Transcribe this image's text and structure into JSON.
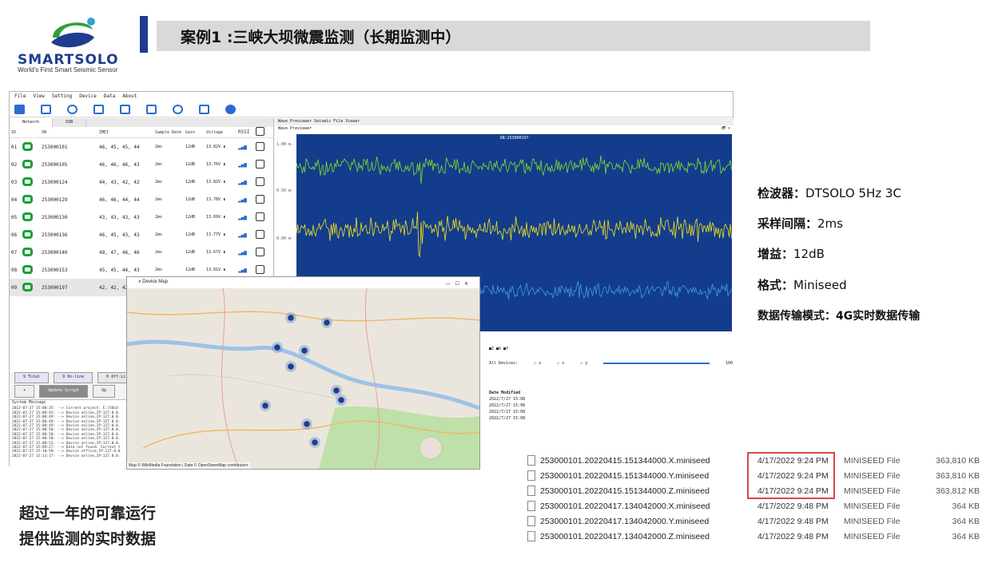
{
  "logo": {
    "brand": "SMARTSOLO",
    "tagline": "World's First Smart Seismic Sensor"
  },
  "title": "案例1 :三峡大坝微震监测（长期监测中）",
  "menu": [
    "File",
    "View",
    "Setting",
    "Device",
    "Data",
    "About"
  ],
  "left_tabs": [
    "Network",
    "USB"
  ],
  "table_headers": [
    "ID",
    "SN",
    "IMEI",
    "Sample Rate",
    "Gain",
    "Voltage",
    "RSSI"
  ],
  "devices": [
    {
      "id": "01",
      "sn": "253000101",
      "sw": "46, 45, 45, 44",
      "rate": "2ms",
      "gain": "12dB",
      "volt": "13.82V"
    },
    {
      "id": "02",
      "sn": "253000105",
      "sw": "46, 46, 46, 43",
      "rate": "2ms",
      "gain": "12dB",
      "volt": "13.76V"
    },
    {
      "id": "03",
      "sn": "253000124",
      "sw": "44, 43, 42, 42",
      "rate": "2ms",
      "gain": "12dB",
      "volt": "13.82V"
    },
    {
      "id": "04",
      "sn": "253000129",
      "sw": "46, 46, 44, 44",
      "rate": "2ms",
      "gain": "12dB",
      "volt": "13.78V"
    },
    {
      "id": "05",
      "sn": "253000130",
      "sw": "43, 43, 43, 43",
      "rate": "2ms",
      "gain": "12dB",
      "volt": "13.69V"
    },
    {
      "id": "06",
      "sn": "253000136",
      "sw": "46, 45, 43, 43",
      "rate": "2ms",
      "gain": "12dB",
      "volt": "13.77V"
    },
    {
      "id": "07",
      "sn": "253000140",
      "sw": "48, 47, 46, 46",
      "rate": "2ms",
      "gain": "12dB",
      "volt": "13.67V"
    },
    {
      "id": "08",
      "sn": "253000153",
      "sw": "45, 45, 44, 43",
      "rate": "2ms",
      "gain": "12dB",
      "volt": "13.81V"
    },
    {
      "id": "09",
      "sn": "253000197",
      "sw": "42, 42, 42, 40",
      "rate": "2ms",
      "gain": "12dB",
      "volt": "13.61V"
    }
  ],
  "buttons": {
    "total": "9 Total",
    "online": "9 On-line",
    "offline": "0 Off-Li",
    "update": "Update Script",
    "up": "Up"
  },
  "sysmsg": {
    "header": "System Message",
    "lines": [
      "2022-07-27 15:08:35: --> Current project: E:/SOLO",
      "2022-07-27 15:08:43: --> Device online,IP:127.0.0.",
      "2022-07-27 15:08:49: --> Device online,IP:127.0.0.",
      "2022-07-27 15:08:49: --> Device online,IP:127.0.0.",
      "2022-07-27 15:08:49: --> Device online,IP:127.0.0.",
      "2022-07-27 15:08:50: --> Device online,IP:127.0.0.",
      "2022-07-27 15:08:50: --> Device online,IP:127.0.0.",
      "2022-07-27 15:08:50: --> Device online,IP:127.0.0.",
      "2022-07-27 15:08:53: --> Device online,IP:127.0.0.",
      "2022-07-27 15:09:27: --> Data not found. Current t",
      "2022-07-27 15:10:58: --> Device offline,IP:127.0.0",
      "2022-07-27 15:11:17: --> Device online,IP:127.0.0."
    ]
  },
  "right_tabs": "Wave Previewer   Seismic File Viewer",
  "wave": {
    "panel": "Wave Previewer",
    "sn": "SN:253000197",
    "y_labels": [
      "1.00 m-",
      "0.50 m-",
      "0.00 m-"
    ],
    "legend": "■Z ■X ■Y",
    "all_devices": "All Devices:",
    "checks": [
      "z",
      "x",
      "y"
    ],
    "value": "100"
  },
  "date_modified": {
    "header": "Date Modified",
    "rows": [
      "2022/7/27 15:08",
      "2022/7/27 15:08",
      "2022/7/27 15:08",
      "2022/7/27 15:08"
    ]
  },
  "map": {
    "title": "Device Map",
    "attribution": "Map © WikiMedia Foundation | Data © OpenStreetMap contributors"
  },
  "specs": [
    {
      "k": "检波器：",
      "v": "DTSOLO 5Hz 3C"
    },
    {
      "k": "采样间隔：",
      "v": "2ms"
    },
    {
      "k": "增益：",
      "v": "12dB"
    },
    {
      "k": "格式：",
      "v": "Miniseed"
    },
    {
      "k": "数据传输模式：",
      "v": "4G实时数据传输"
    }
  ],
  "captions": [
    "超过一年的可靠运行",
    "提供监测的实时数据"
  ],
  "files": [
    {
      "name": "253000101.20220415.151344000.X.miniseed",
      "date": "4/17/2022 9:24 PM",
      "type": "MINISEED File",
      "size": "363,810 KB"
    },
    {
      "name": "253000101.20220415.151344000.Y.miniseed",
      "date": "4/17/2022 9:24 PM",
      "type": "MINISEED File",
      "size": "363,810 KB"
    },
    {
      "name": "253000101.20220415.151344000.Z.miniseed",
      "date": "4/17/2022 9:24 PM",
      "type": "MINISEED File",
      "size": "363,812 KB"
    },
    {
      "name": "253000101.20220417.134042000.X.miniseed",
      "date": "4/17/2022 9:48 PM",
      "type": "MINISEED File",
      "size": "364 KB"
    },
    {
      "name": "253000101.20220417.134042000.Y.miniseed",
      "date": "4/17/2022 9:48 PM",
      "type": "MINISEED File",
      "size": "364 KB"
    },
    {
      "name": "253000101.20220417.134042000.Z.miniseed",
      "date": "4/17/2022 9:48 PM",
      "type": "MINISEED File",
      "size": "364 KB"
    }
  ]
}
